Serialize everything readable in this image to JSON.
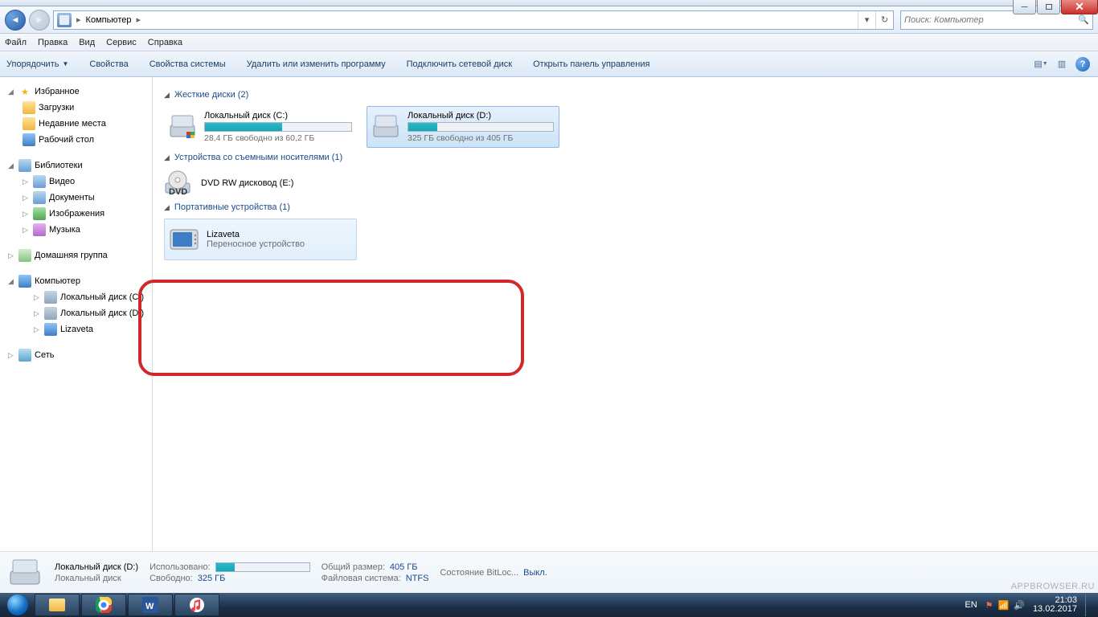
{
  "window": {
    "min": "_",
    "max": "□",
    "close": "✕"
  },
  "nav": {
    "crumb_root": "Компьютер",
    "refresh_tip": "↻",
    "dropdown_tip": "▾"
  },
  "search": {
    "placeholder": "Поиск: Компьютер"
  },
  "menu": {
    "file": "Файл",
    "edit": "Правка",
    "view": "Вид",
    "service": "Сервис",
    "help": "Справка"
  },
  "toolbar": {
    "organize": "Упорядочить",
    "properties": "Свойства",
    "sys_properties": "Свойства системы",
    "uninstall": "Удалить или изменить программу",
    "map_drive": "Подключить сетевой диск",
    "control_panel": "Открыть панель управления"
  },
  "tree": {
    "favorites": "Избранное",
    "downloads": "Загрузки",
    "recent": "Недавние места",
    "desktop": "Рабочий стол",
    "libraries": "Библиотеки",
    "video": "Видео",
    "documents": "Документы",
    "pictures": "Изображения",
    "music": "Музыка",
    "homegroup": "Домашняя группа",
    "computer": "Компьютер",
    "drive_c": "Локальный диск (C:)",
    "drive_d": "Локальный диск (D:)",
    "lizaveta": "Lizaveta",
    "network": "Сеть"
  },
  "content": {
    "hdd_header": "Жесткие диски (2)",
    "drive_c": {
      "name": "Локальный диск (C:)",
      "free": "28,4 ГБ свободно из 60,2 ГБ",
      "fill_pct": 53
    },
    "drive_d": {
      "name": "Локальный диск (D:)",
      "free": "325 ГБ свободно из 405 ГБ",
      "fill_pct": 20
    },
    "removable_header": "Устройства со съемными носителями (1)",
    "dvd": "DVD RW дисковод (E:)",
    "portable_header": "Портативные устройства (1)",
    "portable_name": "Lizaveta",
    "portable_sub": "Переносное устройство"
  },
  "details": {
    "title": "Локальный диск (D:)",
    "type": "Локальный диск",
    "used_k": "Использовано:",
    "free_k": "Свободно:",
    "free_v": "325 ГБ",
    "total_k": "Общий размер:",
    "total_v": "405 ГБ",
    "fs_k": "Файловая система:",
    "fs_v": "NTFS",
    "bitlocker_k": "Состояние BitLoc...",
    "bitlocker_v": "Выкл.",
    "used_fill_pct": 20
  },
  "taskbar": {
    "lang": "EN",
    "time": "21:03",
    "date": "13.02.2017"
  },
  "watermark": "APPBROWSER.RU"
}
